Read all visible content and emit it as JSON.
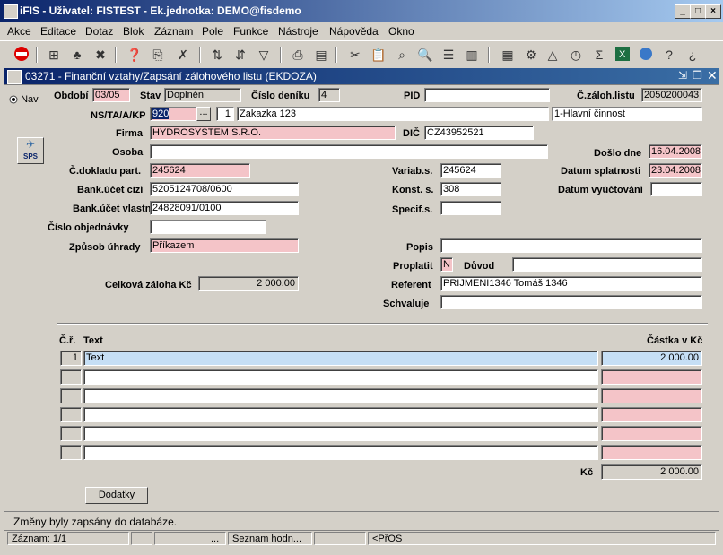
{
  "window": {
    "title": "iFIS - Uživatel: FISTEST - Ek.jednotka: DEMO@fisdemo"
  },
  "menu": [
    "Akce",
    "Editace",
    "Dotaz",
    "Blok",
    "Záznam",
    "Pole",
    "Funkce",
    "Nástroje",
    "Nápověda",
    "Okno"
  ],
  "form": {
    "title": "03271 - Finanční vztahy/Zapsání zálohového listu (EKDOZA)",
    "nav_label": "Nav",
    "sps_label": "SPS",
    "obdobi": {
      "label": "Období",
      "value": "03/05"
    },
    "stav": {
      "label": "Stav",
      "value": "Doplněn"
    },
    "cislo_deniku": {
      "label": "Číslo deníku",
      "value": "4"
    },
    "pid": {
      "label": "PID",
      "value": ""
    },
    "c_zaloh_listu": {
      "label": "Č.záloh.listu",
      "value": "2050200043"
    },
    "ns": {
      "label": "NS/TA/A/KP",
      "code": "920",
      "ellipsis": "...",
      "ta": "1",
      "zakazka": "Zakazka 123",
      "cinnost": "1-Hlavní činnost"
    },
    "firma": {
      "label": "Firma",
      "value": "HYDROSYSTEM S.R.O."
    },
    "dic": {
      "label": "DIČ",
      "value": "CZ43952521"
    },
    "osoba": {
      "label": "Osoba",
      "value": ""
    },
    "doslo_dne": {
      "label": "Došlo dne",
      "value": "16.04.2008"
    },
    "c_dokladu": {
      "label": "Č.dokladu part.",
      "value": "245624"
    },
    "variab": {
      "label": "Variab.s.",
      "value": "245624"
    },
    "datum_splatnosti": {
      "label": "Datum splatnosti",
      "value": "23.04.2008"
    },
    "bank_cizi": {
      "label": "Bank.účet cizí",
      "value": "5205124708/0600"
    },
    "konst": {
      "label": "Konst. s.",
      "value": "308"
    },
    "datum_vyuct": {
      "label": "Datum vyúčtování",
      "value": ""
    },
    "bank_vlastni": {
      "label": "Bank.účet vlastní",
      "value": "24828091/0100"
    },
    "specif": {
      "label": "Specif.s.",
      "value": ""
    },
    "cislo_objednavky": {
      "label": "Číslo objednávky",
      "value": ""
    },
    "zpusob_uhrady": {
      "label": "Způsob úhrady",
      "value": "Příkazem"
    },
    "popis": {
      "label": "Popis",
      "value": ""
    },
    "proplatit": {
      "label": "Proplatit",
      "value": "N"
    },
    "duvod": {
      "label": "Důvod",
      "value": ""
    },
    "celkova_zaloha": {
      "label": "Celková záloha Kč",
      "value": "2 000.00"
    },
    "referent": {
      "label": "Referent",
      "value": "PRIJMENI1346 Tomáš 1346"
    },
    "schvaluje": {
      "label": "Schvaluje",
      "value": ""
    },
    "items_header": {
      "cr": "Č.ř.",
      "text": "Text",
      "castka": "Částka v Kč"
    },
    "items": [
      {
        "cr": "1",
        "text": "Text",
        "castka": "2 000.00"
      },
      {
        "cr": "",
        "text": "",
        "castka": ""
      },
      {
        "cr": "",
        "text": "",
        "castka": ""
      },
      {
        "cr": "",
        "text": "",
        "castka": ""
      },
      {
        "cr": "",
        "text": "",
        "castka": ""
      },
      {
        "cr": "",
        "text": "",
        "castka": ""
      }
    ],
    "total": {
      "label": "Kč",
      "value": "2 000.00"
    },
    "dodatky_button": "Dodatky"
  },
  "status": {
    "message": "Změny byly zapsány do databáze.",
    "zaznam": "Záznam: 1/1",
    "dots": "...",
    "seznam": "Seznam hodn...",
    "pros": "<PřOS"
  }
}
